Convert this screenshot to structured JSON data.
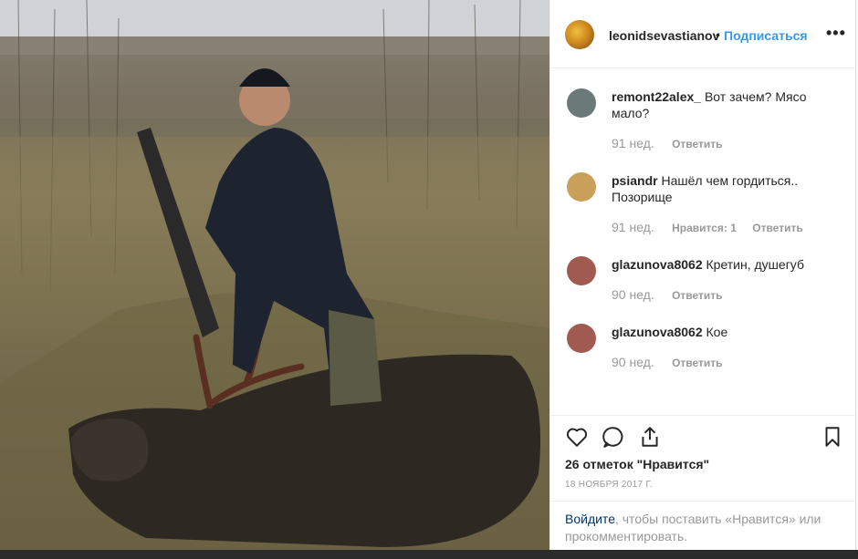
{
  "post": {
    "author": "leonidsevastianov",
    "bullet": "•",
    "follow_label": "Подписаться",
    "more_label": "•••",
    "avatar_color": "#d08a20"
  },
  "comments": [
    {
      "user": "remont22alex_",
      "text": "Вот зачем? Мясо мало?",
      "age": "91 нед.",
      "likes": "",
      "reply_label": "Ответить",
      "avatar_color": "#6b7a78"
    },
    {
      "user": "psiandr",
      "text": "Нашёл чем гордиться.. Позорище",
      "age": "91 нед.",
      "likes": "Нравится: 1",
      "reply_label": "Ответить",
      "avatar_color": "#c8a05a"
    },
    {
      "user": "glazunova8062",
      "text": "Кретин, душегуб",
      "age": "90 нед.",
      "likes": "",
      "reply_label": "Ответить",
      "avatar_color": "#a05a50"
    },
    {
      "user": "glazunova8062",
      "text": "Кое",
      "age": "90 нед.",
      "likes": "",
      "reply_label": "Ответить",
      "avatar_color": "#a05a50"
    }
  ],
  "actions": {
    "like_icon": "heart-icon",
    "comment_icon": "comment-icon",
    "share_icon": "share-icon",
    "save_icon": "bookmark-icon",
    "likes_text": "26 отметок \"Нравится\"",
    "date_text": "18 НОЯБРЯ 2017 Г."
  },
  "login": {
    "link_text": "Войдите",
    "rest_text": ", чтобы поставить «Нравится» или прокомментировать."
  }
}
